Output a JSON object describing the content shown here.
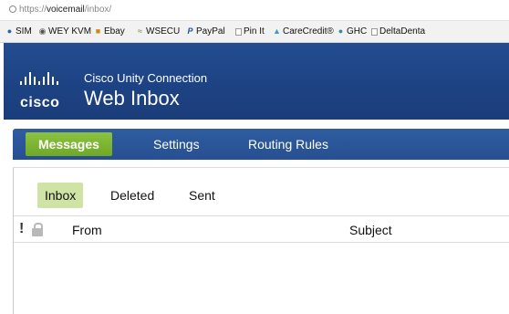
{
  "browser": {
    "url_prefix": "https://",
    "url_host": "voicemail",
    "url_path": "/inbox/",
    "bookmarks": [
      {
        "label": "SIM",
        "icon": "circle-icon",
        "color": "#2a5fb0"
      },
      {
        "label": "WEY KVM",
        "icon": "eye-icon",
        "color": "#555555"
      },
      {
        "label": "Ebay",
        "icon": "shop-icon",
        "color": "#d08a10"
      },
      {
        "label": "WSECU",
        "icon": "bird-icon",
        "color": "#5a8a2a"
      },
      {
        "label": "PayPal",
        "icon": "paypal-icon",
        "color": "#1f4f9a"
      },
      {
        "label": "Pin It",
        "icon": "page-icon",
        "color": "#9a9a9a"
      },
      {
        "label": "CareCredit®",
        "icon": "leaf-icon",
        "color": "#3aa0c0"
      },
      {
        "label": "GHC",
        "icon": "globe-icon",
        "color": "#3a8a9a"
      },
      {
        "label": "DeltaDenta",
        "icon": "page-icon",
        "color": "#9a9a9a"
      }
    ]
  },
  "header": {
    "logo_text": "cisco",
    "product_name": "Cisco Unity Connection",
    "app_name": "Web Inbox"
  },
  "main_tabs": [
    {
      "label": "Messages",
      "active": true
    },
    {
      "label": "Settings",
      "active": false
    },
    {
      "label": "Routing Rules",
      "active": false
    }
  ],
  "sub_tabs": [
    {
      "label": "Inbox",
      "active": true
    },
    {
      "label": "Deleted",
      "active": false
    },
    {
      "label": "Sent",
      "active": false
    }
  ],
  "columns": {
    "flag": "!",
    "from": "From",
    "subject": "Subject"
  },
  "colors": {
    "header_blue": "#1d4283",
    "active_tab_green": "#7ab332",
    "active_subtab_green": "#cfe3a4"
  }
}
